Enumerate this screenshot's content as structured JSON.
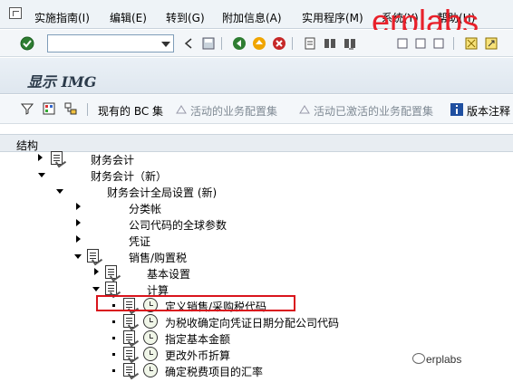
{
  "menubar": {
    "items": [
      "实施指南(I)",
      "编辑(E)",
      "转到(G)",
      "附加信息(A)",
      "实用程序(M)",
      "系统(Y)",
      "帮助(H)"
    ]
  },
  "watermark_top": "erplabs",
  "toolbar": {
    "command_value": "",
    "icons": [
      "enter-icon",
      "back-icon",
      "exit-icon",
      "cancel-icon",
      "print-icon",
      "find-icon",
      "find-next-icon",
      "first-page-icon",
      "prev-page-icon",
      "next-page-icon",
      "last-page-icon",
      "create-session-icon",
      "shortcut-icon",
      "help-icon"
    ]
  },
  "title": "显示 IMG",
  "app_toolbar": {
    "bc_sets": "现有的 BC 集",
    "active_bc": "活动的业务配置集",
    "activated_bc": "活动已激活的业务配置集",
    "release_notes": "版本注释"
  },
  "tree": {
    "header": "结构",
    "rows": [
      {
        "text": "财务会计"
      },
      {
        "text": "财务会计（新）"
      },
      {
        "text": "财务会计全局设置 (新)"
      },
      {
        "text": "分类帐"
      },
      {
        "text": "公司代码的全球参数"
      },
      {
        "text": "凭证"
      },
      {
        "text": "销售/购置税"
      },
      {
        "text": "基本设置"
      },
      {
        "text": "计算"
      },
      {
        "text": "定义销售/采购税代码"
      },
      {
        "text": "为税收确定向凭证日期分配公司代码"
      },
      {
        "text": "指定基本金额"
      },
      {
        "text": "更改外币折算"
      },
      {
        "text": "确定税费项目的汇率"
      }
    ]
  },
  "watermark_bottom": "erplabs",
  "colors": {
    "brand": "#e8202a",
    "highlight": "#d9141c"
  }
}
